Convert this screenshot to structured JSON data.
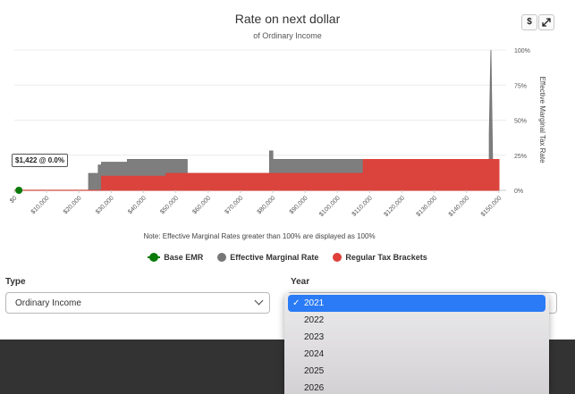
{
  "chart_data": {
    "type": "area",
    "title": "Rate on next dollar",
    "subtitle": "of Ordinary Income",
    "ylabel_right": "Effective Marginal Tax Rate",
    "xlim": [
      0,
      150000
    ],
    "ylim": [
      0,
      100
    ],
    "x_ticks": [
      "$0",
      "$10,000",
      "$20,000",
      "$30,000",
      "$40,000",
      "$50,000",
      "$60,000",
      "$70,000",
      "$80,000",
      "$90,000",
      "$100,000",
      "$110,000",
      "$120,000",
      "$130,000",
      "$140,000",
      "$150,000"
    ],
    "y_ticks": [
      "0%",
      "25%",
      "50%",
      "75%",
      "100%"
    ],
    "grid": true,
    "series": [
      {
        "name": "Effective Marginal Rate",
        "color": "#777777",
        "points": [
          [
            0,
            0
          ],
          [
            23000,
            0
          ],
          [
            23000,
            12
          ],
          [
            26000,
            12
          ],
          [
            26000,
            18
          ],
          [
            27000,
            18
          ],
          [
            27000,
            20
          ],
          [
            35000,
            20
          ],
          [
            35000,
            22
          ],
          [
            53500,
            22
          ],
          [
            53500,
            12
          ],
          [
            79000,
            12
          ],
          [
            79000,
            28
          ],
          [
            80000,
            28
          ],
          [
            80000,
            22
          ],
          [
            108000,
            22
          ],
          [
            108000,
            22
          ],
          [
            147000,
            22
          ],
          [
            147000,
            40
          ],
          [
            147500,
            100
          ],
          [
            148000,
            22
          ],
          [
            150000,
            22
          ]
        ]
      },
      {
        "name": "Regular Tax Brackets",
        "color": "#e0403a",
        "points": [
          [
            0,
            0
          ],
          [
            27000,
            0
          ],
          [
            27000,
            10
          ],
          [
            47000,
            10
          ],
          [
            47000,
            12
          ],
          [
            80000,
            12
          ],
          [
            80000,
            12
          ],
          [
            108000,
            12
          ],
          [
            108000,
            22
          ],
          [
            150000,
            22
          ]
        ]
      },
      {
        "name": "Base EMR",
        "color": "#0a7a0a",
        "points": [
          [
            1422,
            0
          ]
        ]
      }
    ],
    "tooltip": "$1,422 @ 0.0%",
    "note": "Note: Effective Marginal Rates greater than 100% are displayed as 100%"
  },
  "toolbar": {
    "dollar_label": "$",
    "expand_icon": "expand-icon"
  },
  "legend": [
    {
      "label": "Base EMR",
      "color": "#0a7a0a"
    },
    {
      "label": "Effective Marginal Rate",
      "color": "#777777"
    },
    {
      "label": "Regular Tax Brackets",
      "color": "#e0403a"
    }
  ],
  "form": {
    "type_label": "Type",
    "type_value": "Ordinary Income",
    "year_label": "Year",
    "year_options": [
      "2021",
      "2022",
      "2023",
      "2024",
      "2025",
      "2026"
    ],
    "year_selected": "2021"
  }
}
